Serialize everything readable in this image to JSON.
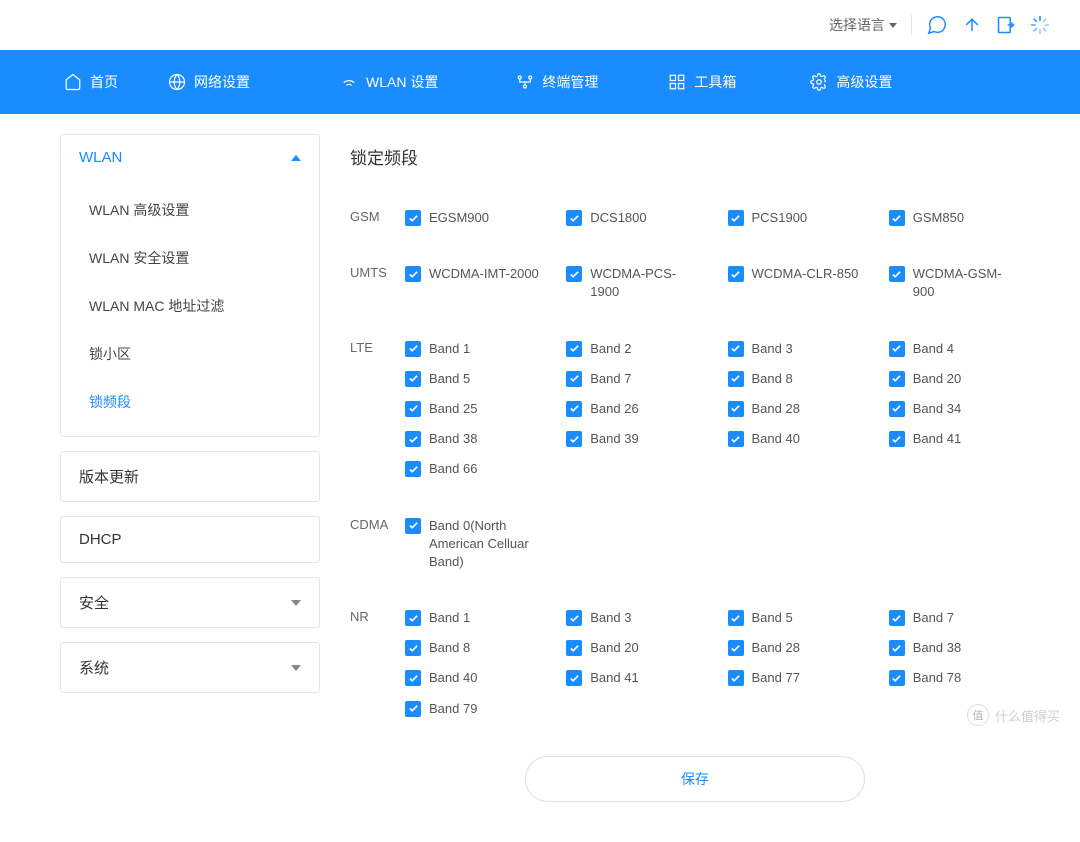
{
  "topbar": {
    "lang_label": "选择语言"
  },
  "nav": {
    "home": "首页",
    "network": "网络设置",
    "wlan": "WLAN 设置",
    "terminal": "终端管理",
    "toolbox": "工具箱",
    "advanced": "高级设置"
  },
  "sidebar": {
    "wlan": {
      "title": "WLAN",
      "items": [
        "WLAN 高级设置",
        "WLAN 安全设置",
        "WLAN MAC 地址过滤",
        "锁小区",
        "锁频段"
      ]
    },
    "groups": [
      "版本更新",
      "DHCP",
      "安全",
      "系统"
    ]
  },
  "main": {
    "title": "锁定频段",
    "save": "保存",
    "sections": {
      "gsm": {
        "label": "GSM",
        "bands": [
          "EGSM900",
          "DCS1800",
          "PCS1900",
          "GSM850"
        ]
      },
      "umts": {
        "label": "UMTS",
        "bands": [
          "WCDMA-IMT-2000",
          "WCDMA-PCS-1900",
          "WCDMA-CLR-850",
          "WCDMA-GSM-900"
        ]
      },
      "lte": {
        "label": "LTE",
        "bands": [
          "Band 1",
          "Band 2",
          "Band 3",
          "Band 4",
          "Band 5",
          "Band 7",
          "Band 8",
          "Band 20",
          "Band 25",
          "Band 26",
          "Band 28",
          "Band 34",
          "Band 38",
          "Band 39",
          "Band 40",
          "Band 41",
          "Band 66"
        ]
      },
      "cdma": {
        "label": "CDMA",
        "bands": [
          "Band 0(North American Celluar Band)"
        ]
      },
      "nr": {
        "label": "NR",
        "bands": [
          "Band 1",
          "Band 3",
          "Band 5",
          "Band 7",
          "Band 8",
          "Band 20",
          "Band 28",
          "Band 38",
          "Band 40",
          "Band 41",
          "Band 77",
          "Band 78",
          "Band 79"
        ]
      }
    }
  },
  "watermark": "什么值得买"
}
